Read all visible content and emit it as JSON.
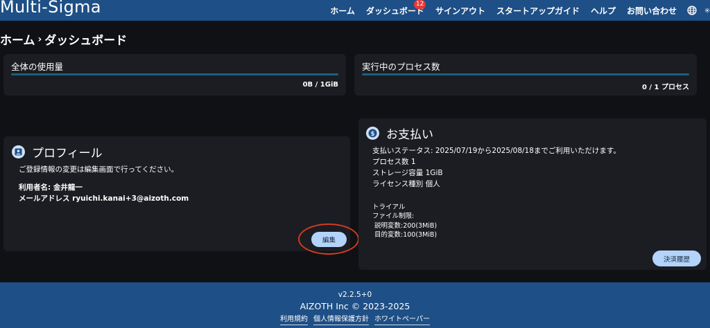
{
  "app": {
    "title": "Multi-Sigma"
  },
  "nav": {
    "items": [
      {
        "label": "ホーム"
      },
      {
        "label": "ダッシュボード",
        "badge": "12"
      },
      {
        "label": "サインアウト"
      },
      {
        "label": "スタートアップガイド"
      },
      {
        "label": "ヘルプ"
      },
      {
        "label": "お問い合わせ"
      }
    ],
    "icons": [
      "globe-icon",
      "settings-icon"
    ]
  },
  "breadcrumb": {
    "home": "ホーム",
    "separator": "›",
    "current": "ダッシュボード"
  },
  "usage": [
    {
      "title": "全体の使用量",
      "value": "0B / 1GiB",
      "fill_fraction": 1.0
    },
    {
      "title": "実行中のプロセス数",
      "value": "0 / 1 プロセス",
      "fill_fraction": 1.0
    }
  ],
  "profile": {
    "title": "プロフィール",
    "icon": "account-box-icon",
    "note": "ご登録情報の変更は編集画面で行ってください。",
    "user_name": "利用者名: 金井龍一",
    "email": "メールアドレス ryuichi.kanai+3@aizoth.com",
    "edit_label": "編集"
  },
  "payment": {
    "title": "お支払い",
    "icon": "dollar-circle-icon",
    "status": "支払いステータス: 2025/07/19から2025/08/18までご利用いただけます。",
    "processes": "プロセス数 1",
    "storage": "ストレージ容量 1GiB",
    "license": "ライセンス種別 個人",
    "trial": "トライアル",
    "file_limit": "ファイル制限:",
    "explanatory": "説明変数:200(3MiB)",
    "target": "目的変数:100(3MiB)",
    "history_label": "決済履歴"
  },
  "footer": {
    "version": "v2.2.5+0",
    "copyright": "AIZOTH Inc © 2023-2025",
    "links": [
      "利用規約",
      "個人情報保護方針",
      "ホワイトペーパー"
    ]
  },
  "colors": {
    "header": "#1e4f86",
    "background": "#0f1115",
    "card": "#1b1d22",
    "button": "#b3d3fb",
    "highlight": "#d43a22",
    "badge": "#e53935"
  }
}
